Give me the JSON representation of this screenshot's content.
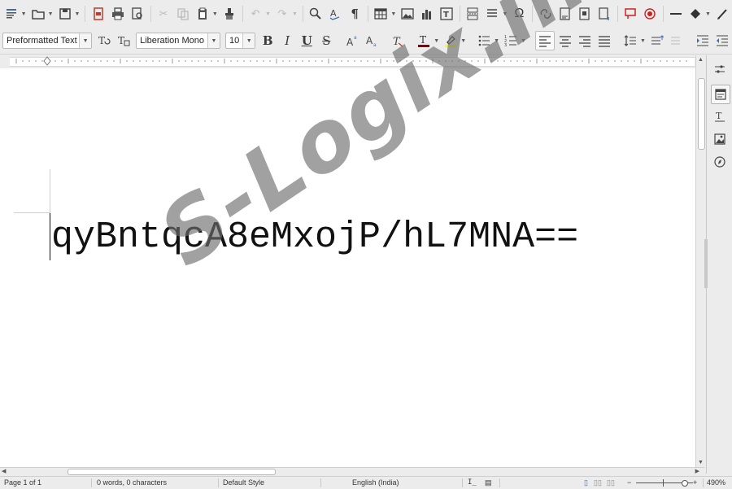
{
  "toolbar_formatting": {
    "paragraph_style": "Preformatted Text",
    "font_name": "Liberation Mono",
    "font_size": "10"
  },
  "document": {
    "text": "qyBntqcA8eMxojP/hL7MNA=="
  },
  "watermark": "S-Logix.in",
  "status_bar": {
    "page": "Page 1 of 1",
    "word_count": "0 words, 0 characters",
    "page_style": "Default Style",
    "language": "English (India)",
    "zoom": "490%"
  },
  "colors": {
    "font_color": "#8b0000",
    "highlight_color": "#ffff00",
    "direct_export_pdf": "#c0392b",
    "track_changes": "#d02020"
  }
}
